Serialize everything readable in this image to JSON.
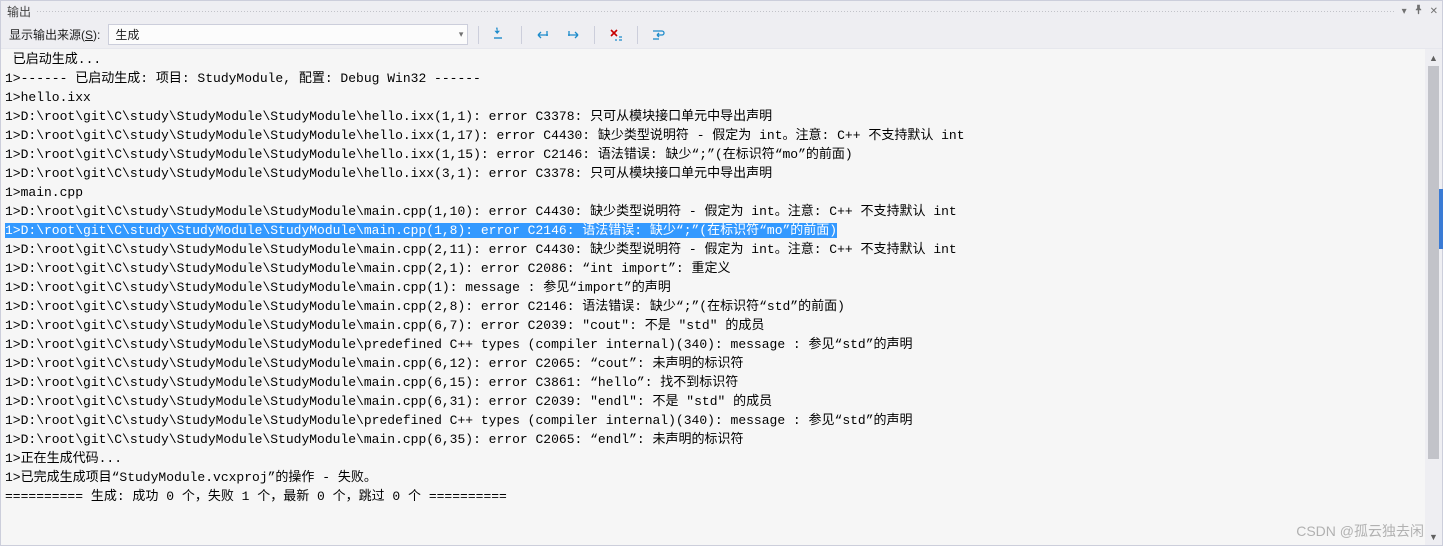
{
  "panel": {
    "title": "输出",
    "window_controls": {
      "down": "▾",
      "pin": "📌",
      "close": "✕"
    }
  },
  "toolbar": {
    "label_prefix": "显示输出来源(",
    "label_accel": "S",
    "label_suffix": "):",
    "dropdown_value": "生成",
    "buttons": {
      "a": "goto-prev-message",
      "b": "goto-next-message",
      "c": "word-wrap",
      "d": "clear-all",
      "e": "toggle-wrap"
    }
  },
  "output": {
    "lines": [
      " 已启动生成...",
      "1>------ 已启动生成: 项目: StudyModule, 配置: Debug Win32 ------",
      "1>hello.ixx",
      "1>D:\\root\\git\\C\\study\\StudyModule\\StudyModule\\hello.ixx(1,1): error C3378: 只可从模块接口单元中导出声明",
      "1>D:\\root\\git\\C\\study\\StudyModule\\StudyModule\\hello.ixx(1,17): error C4430: 缺少类型说明符 - 假定为 int。注意: C++ 不支持默认 int",
      "1>D:\\root\\git\\C\\study\\StudyModule\\StudyModule\\hello.ixx(1,15): error C2146: 语法错误: 缺少“;”(在标识符“mo”的前面)",
      "1>D:\\root\\git\\C\\study\\StudyModule\\StudyModule\\hello.ixx(3,1): error C3378: 只可从模块接口单元中导出声明",
      "1>main.cpp",
      "1>D:\\root\\git\\C\\study\\StudyModule\\StudyModule\\main.cpp(1,10): error C4430: 缺少类型说明符 - 假定为 int。注意: C++ 不支持默认 int",
      "1>D:\\root\\git\\C\\study\\StudyModule\\StudyModule\\main.cpp(1,8): error C2146: 语法错误: 缺少“;”(在标识符“mo”的前面)",
      "1>D:\\root\\git\\C\\study\\StudyModule\\StudyModule\\main.cpp(2,11): error C4430: 缺少类型说明符 - 假定为 int。注意: C++ 不支持默认 int",
      "1>D:\\root\\git\\C\\study\\StudyModule\\StudyModule\\main.cpp(2,1): error C2086: “int import”: 重定义",
      "1>D:\\root\\git\\C\\study\\StudyModule\\StudyModule\\main.cpp(1): message : 参见“import”的声明",
      "1>D:\\root\\git\\C\\study\\StudyModule\\StudyModule\\main.cpp(2,8): error C2146: 语法错误: 缺少“;”(在标识符“std”的前面)",
      "1>D:\\root\\git\\C\\study\\StudyModule\\StudyModule\\main.cpp(6,7): error C2039: \"cout\": 不是 \"std\" 的成员",
      "1>D:\\root\\git\\C\\study\\StudyModule\\StudyModule\\predefined C++ types (compiler internal)(340): message : 参见“std”的声明",
      "1>D:\\root\\git\\C\\study\\StudyModule\\StudyModule\\main.cpp(6,12): error C2065: “cout”: 未声明的标识符",
      "1>D:\\root\\git\\C\\study\\StudyModule\\StudyModule\\main.cpp(6,15): error C3861: “hello”: 找不到标识符",
      "1>D:\\root\\git\\C\\study\\StudyModule\\StudyModule\\main.cpp(6,31): error C2039: \"endl\": 不是 \"std\" 的成员",
      "1>D:\\root\\git\\C\\study\\StudyModule\\StudyModule\\predefined C++ types (compiler internal)(340): message : 参见“std”的声明",
      "1>D:\\root\\git\\C\\study\\StudyModule\\StudyModule\\main.cpp(6,35): error C2065: “endl”: 未声明的标识符",
      "1>正在生成代码...",
      "1>已完成生成项目“StudyModule.vcxproj”的操作 - 失败。",
      "========== 生成: 成功 0 个，失败 1 个，最新 0 个，跳过 0 个 =========="
    ],
    "selected_index": 9
  },
  "colors": {
    "selection": "#3399ff",
    "panel_bg": "#eeeef2",
    "content_bg": "#f6f6f6"
  },
  "watermark": "CSDN @孤云独去闲"
}
